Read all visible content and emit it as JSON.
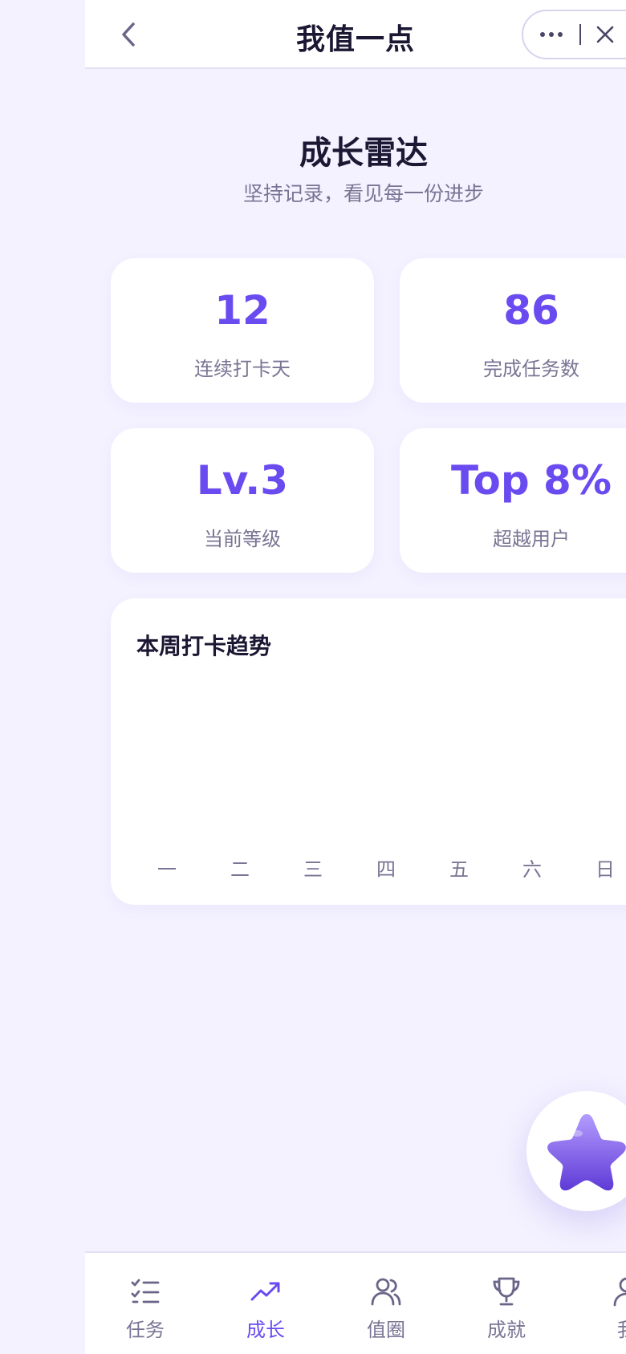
{
  "header": {
    "title": "我值一点",
    "back_icon": "chevron-left-icon",
    "more_icon": "more-dots-icon",
    "close_icon": "close-icon"
  },
  "hero": {
    "title": "成长雷达",
    "subtitle": "坚持记录，看见每一份进步"
  },
  "stats": [
    {
      "value": "12",
      "label": "连续打卡天"
    },
    {
      "value": "86",
      "label": "完成任务数"
    },
    {
      "value": "Lv.3",
      "label": "当前等级"
    },
    {
      "value": "Top 8%",
      "label": "超越用户"
    }
  ],
  "chart": {
    "title": "本周打卡趋势",
    "days": [
      "一",
      "二",
      "三",
      "四",
      "五",
      "六",
      "日"
    ]
  },
  "fab": {
    "icon": "star-mascot-icon"
  },
  "tabbar": {
    "items": [
      {
        "label": "任务",
        "icon": "task-list-icon",
        "active": false
      },
      {
        "label": "成长",
        "icon": "trend-up-icon",
        "active": true
      },
      {
        "label": "值圈",
        "icon": "users-icon",
        "active": false
      },
      {
        "label": "成就",
        "icon": "trophy-icon",
        "active": false
      },
      {
        "label": "我",
        "icon": "user-icon",
        "active": false
      }
    ]
  },
  "colors": {
    "accent": "#6a4bf0",
    "background": "#f4f2ff",
    "text_primary": "#1c1733",
    "text_secondary": "#7a7494"
  }
}
